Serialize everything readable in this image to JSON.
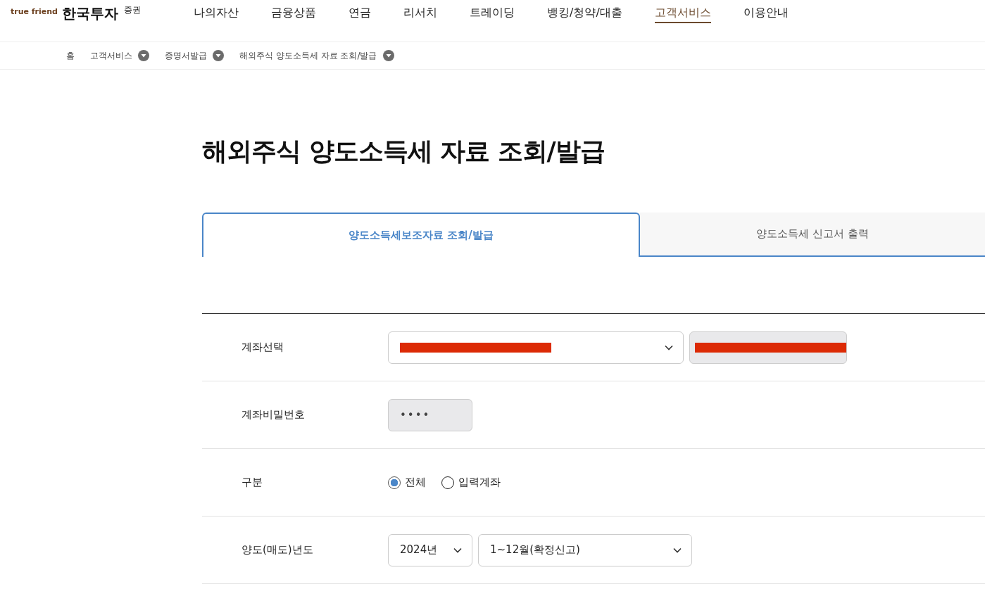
{
  "logo": {
    "tagline": "true friend",
    "name": "한국투자",
    "suffix": "증권"
  },
  "nav": [
    {
      "label": "나의자산",
      "selected": false
    },
    {
      "label": "금융상품",
      "selected": false
    },
    {
      "label": "연금",
      "selected": false
    },
    {
      "label": "리서치",
      "selected": false
    },
    {
      "label": "트레이딩",
      "selected": false
    },
    {
      "label": "뱅킹/청약/대출",
      "selected": false
    },
    {
      "label": "고객서비스",
      "selected": true
    },
    {
      "label": "이용안내",
      "selected": false
    }
  ],
  "breadcrumb": [
    {
      "label": "홈",
      "dropdown": false
    },
    {
      "label": "고객서비스",
      "dropdown": true
    },
    {
      "label": "증명서발급",
      "dropdown": true
    },
    {
      "label": "해외주식 양도소득세 자료 조회/발급",
      "dropdown": true
    }
  ],
  "title": "해외주식 양도소득세 자료 조회/발급",
  "tabs": [
    {
      "label": "양도소득세보조자료 조회/발급",
      "selected": true
    },
    {
      "label": "양도소득세 신고서 출력",
      "selected": false
    }
  ],
  "form": {
    "rows": [
      {
        "kind": "account",
        "label": "계좌선택",
        "select": {
          "redacted": true
        },
        "holder": {
          "redacted": true
        }
      },
      {
        "kind": "password",
        "label": "계좌비밀번호",
        "value": "••••"
      },
      {
        "kind": "radio",
        "label": "구분",
        "options": [
          {
            "label": "전체",
            "selected": true
          },
          {
            "label": "입력계좌",
            "selected": false
          }
        ]
      },
      {
        "kind": "selects",
        "label": "양도(매도)년도",
        "selects": [
          {
            "value": "2024년"
          },
          {
            "value": "1~12월(확정신고)"
          }
        ]
      }
    ]
  }
}
